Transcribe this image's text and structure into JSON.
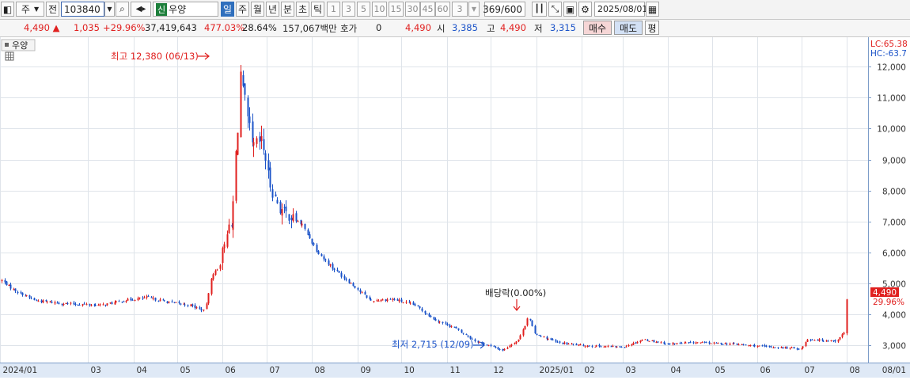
{
  "toolbar": {
    "market": "주",
    "compare": "전",
    "code": "103840",
    "new_badge": "신",
    "stock_name": "우양",
    "periods": [
      "일",
      "주",
      "월",
      "년",
      "분",
      "초",
      "틱"
    ],
    "selected_period": "일",
    "intervals": [
      "1",
      "3",
      "5",
      "10",
      "15",
      "30",
      "45",
      "60"
    ],
    "interval_value": "3",
    "bar_count": "369/600",
    "date": "2025/08/01"
  },
  "quote": {
    "price": "4,490",
    "change": "1,035",
    "change_pct": "+29.96%",
    "volume": "37,419,643",
    "volume_ratio": "477.03%",
    "turnover_pct": "28.64%",
    "amount": "157,067백만",
    "hoga_label": "호가",
    "hoga_value": "0",
    "hoga_price": "4,490",
    "open_label": "시",
    "open": "3,385",
    "high_label": "고",
    "high": "4,490",
    "low_label": "저",
    "low": "3,315",
    "buy_label": "매수",
    "sell_label": "매도",
    "avg_label": "평"
  },
  "chart_data": {
    "type": "candlestick",
    "legend": "우양",
    "y_ticks": [
      "12,000",
      "11,000",
      "10,000",
      "9,000",
      "8,000",
      "7,000",
      "6,000",
      "5,000",
      "4,000",
      "3,000"
    ],
    "ylim": [
      2450,
      12950
    ],
    "x_labels": [
      "2024/01",
      "03",
      "04",
      "05",
      "06",
      "07",
      "08",
      "09",
      "10",
      "11",
      "12",
      "2025/01",
      "02",
      "03",
      "04",
      "05",
      "06",
      "07",
      "08",
      "08/01"
    ],
    "lc_label": "LC:65.38",
    "hc_label": "HC:-63.7",
    "last_price_label": "4,490",
    "last_change_label": "29.96%",
    "annotation_high": "최고 12,380 (06/13)",
    "annotation_low": "최저 2,715 (12/09)",
    "annotation_dividend": "배당락(0.00%)",
    "colors": {
      "up": "#e0201f",
      "down": "#1b53c8",
      "grid": "#dfe4ea"
    },
    "close_anchors": [
      [
        "2024/01/02",
        5100
      ],
      [
        "2024/01/10",
        4800
      ],
      [
        "2024/01/25",
        4450
      ],
      [
        "2024/02/15",
        4350
      ],
      [
        "2024/03/10",
        4300
      ],
      [
        "2024/03/25",
        4450
      ],
      [
        "2024/04/10",
        4550
      ],
      [
        "2024/04/25",
        4400
      ],
      [
        "2024/05/10",
        4300
      ],
      [
        "2024/05/20",
        4100
      ],
      [
        "2024/05/24",
        5200
      ],
      [
        "2024/05/31",
        5700
      ],
      [
        "2024/06/03",
        6700
      ],
      [
        "2024/06/07",
        6800
      ],
      [
        "2024/06/10",
        9200
      ],
      [
        "2024/06/13",
        11800
      ],
      [
        "2024/06/17",
        10500
      ],
      [
        "2024/06/21",
        9400
      ],
      [
        "2024/06/28",
        9600
      ],
      [
        "2024/07/03",
        8200
      ],
      [
        "2024/07/10",
        7400
      ],
      [
        "2024/07/25",
        6900
      ],
      [
        "2024/08/05",
        6000
      ],
      [
        "2024/08/15",
        5500
      ],
      [
        "2024/08/25",
        5100
      ],
      [
        "2024/09/10",
        4450
      ],
      [
        "2024/09/25",
        4500
      ],
      [
        "2024/10/10",
        4300
      ],
      [
        "2024/10/25",
        3800
      ],
      [
        "2024/11/05",
        3600
      ],
      [
        "2024/11/20",
        3150
      ],
      [
        "2024/12/09",
        2850
      ],
      [
        "2024/12/20",
        3200
      ],
      [
        "2024/12/27",
        4000
      ],
      [
        "2024/12/30",
        3400
      ],
      [
        "2025/01/15",
        3100
      ],
      [
        "2025/02/01",
        3000
      ],
      [
        "2025/03/01",
        2950
      ],
      [
        "2025/03/15",
        3200
      ],
      [
        "2025/04/01",
        3050
      ],
      [
        "2025/04/20",
        3100
      ],
      [
        "2025/05/15",
        3050
      ],
      [
        "2025/06/10",
        2950
      ],
      [
        "2025/07/01",
        2900
      ],
      [
        "2025/07/05",
        3200
      ],
      [
        "2025/07/25",
        3150
      ],
      [
        "2025/07/31",
        3455
      ],
      [
        "2025/08/01",
        4490
      ]
    ]
  }
}
